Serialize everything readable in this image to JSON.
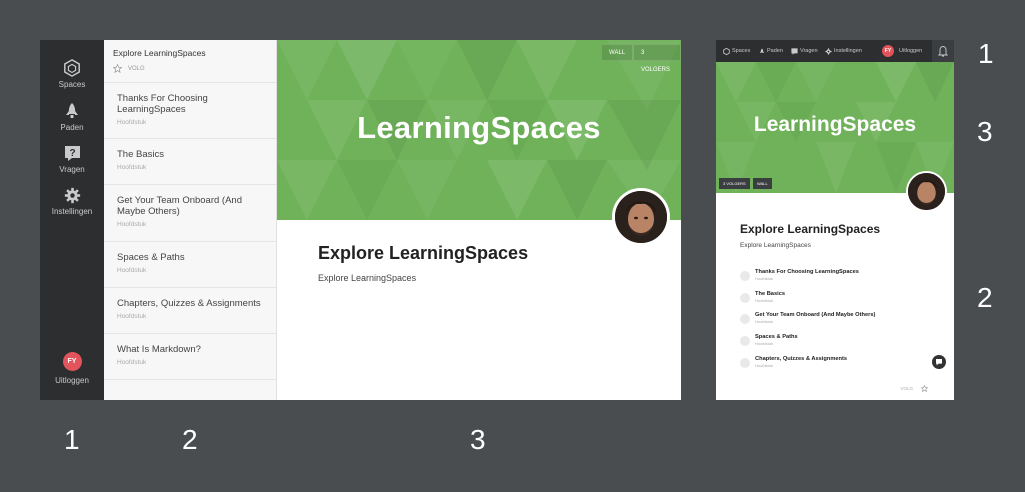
{
  "desktop": {
    "rail": [
      {
        "icon": "spaces-icon",
        "label": "Spaces"
      },
      {
        "icon": "rocket-icon",
        "label": "Paden"
      },
      {
        "icon": "question-icon",
        "label": "Vragen"
      },
      {
        "icon": "gear-icon",
        "label": "Instellingen"
      }
    ],
    "user": {
      "initials": "FY",
      "logout_label": "Uitloggen"
    },
    "chapters_header": {
      "title": "Explore LearningSpaces",
      "follow_label": "VOLG"
    },
    "chapters": [
      {
        "title": "Thanks For Choosing LearningSpaces",
        "subtitle": "Hoofdstuk"
      },
      {
        "title": "The Basics",
        "subtitle": "Hoofdstuk"
      },
      {
        "title": "Get Your Team Onboard (And Maybe Others)",
        "subtitle": "Hoofdstuk"
      },
      {
        "title": "Spaces & Paths",
        "subtitle": "Hoofdstuk"
      },
      {
        "title": "Chapters, Quizzes & Assignments",
        "subtitle": "Hoofdstuk"
      },
      {
        "title": "What Is Markdown?",
        "subtitle": "Hoofdstuk"
      }
    ],
    "banner": {
      "title": "LearningSpaces",
      "wall_label": "WALL",
      "followers_label": "3 VOLGERS",
      "color": "#6fb25a"
    },
    "space": {
      "title": "Explore LearningSpaces",
      "description": "Explore LearningSpaces"
    }
  },
  "mobile": {
    "nav": [
      {
        "icon": "spaces-icon",
        "label": "Spaces"
      },
      {
        "icon": "rocket-icon",
        "label": "Paden"
      },
      {
        "icon": "question-icon",
        "label": "Vragen"
      },
      {
        "icon": "gear-icon",
        "label": "Instellingen"
      }
    ],
    "user": {
      "initials": "FY",
      "logout_label": "Uitloggen"
    },
    "banner": {
      "title": "LearningSpaces",
      "followers_label": "3 VOLGERS",
      "wall_label": "WALL"
    },
    "space": {
      "title": "Explore LearningSpaces",
      "description": "Explore LearningSpaces"
    },
    "chapters": [
      {
        "title": "Thanks For Choosing LearningSpaces",
        "subtitle": "Hoofdstuk"
      },
      {
        "title": "The Basics",
        "subtitle": "Hoofdstuk"
      },
      {
        "title": "Get Your Team Onboard (And Maybe Others)",
        "subtitle": "Hoofdstuk"
      },
      {
        "title": "Spaces & Paths",
        "subtitle": "Hoofdstuk"
      },
      {
        "title": "Chapters, Quizzes & Assignments",
        "subtitle": "Hoofdstuk"
      }
    ],
    "follow_label": "VOLG"
  },
  "labels": {
    "desktop_rail": "1",
    "desktop_chapters": "2",
    "desktop_main": "3",
    "mobile_nav": "1",
    "mobile_banner": "3",
    "mobile_list": "2"
  }
}
